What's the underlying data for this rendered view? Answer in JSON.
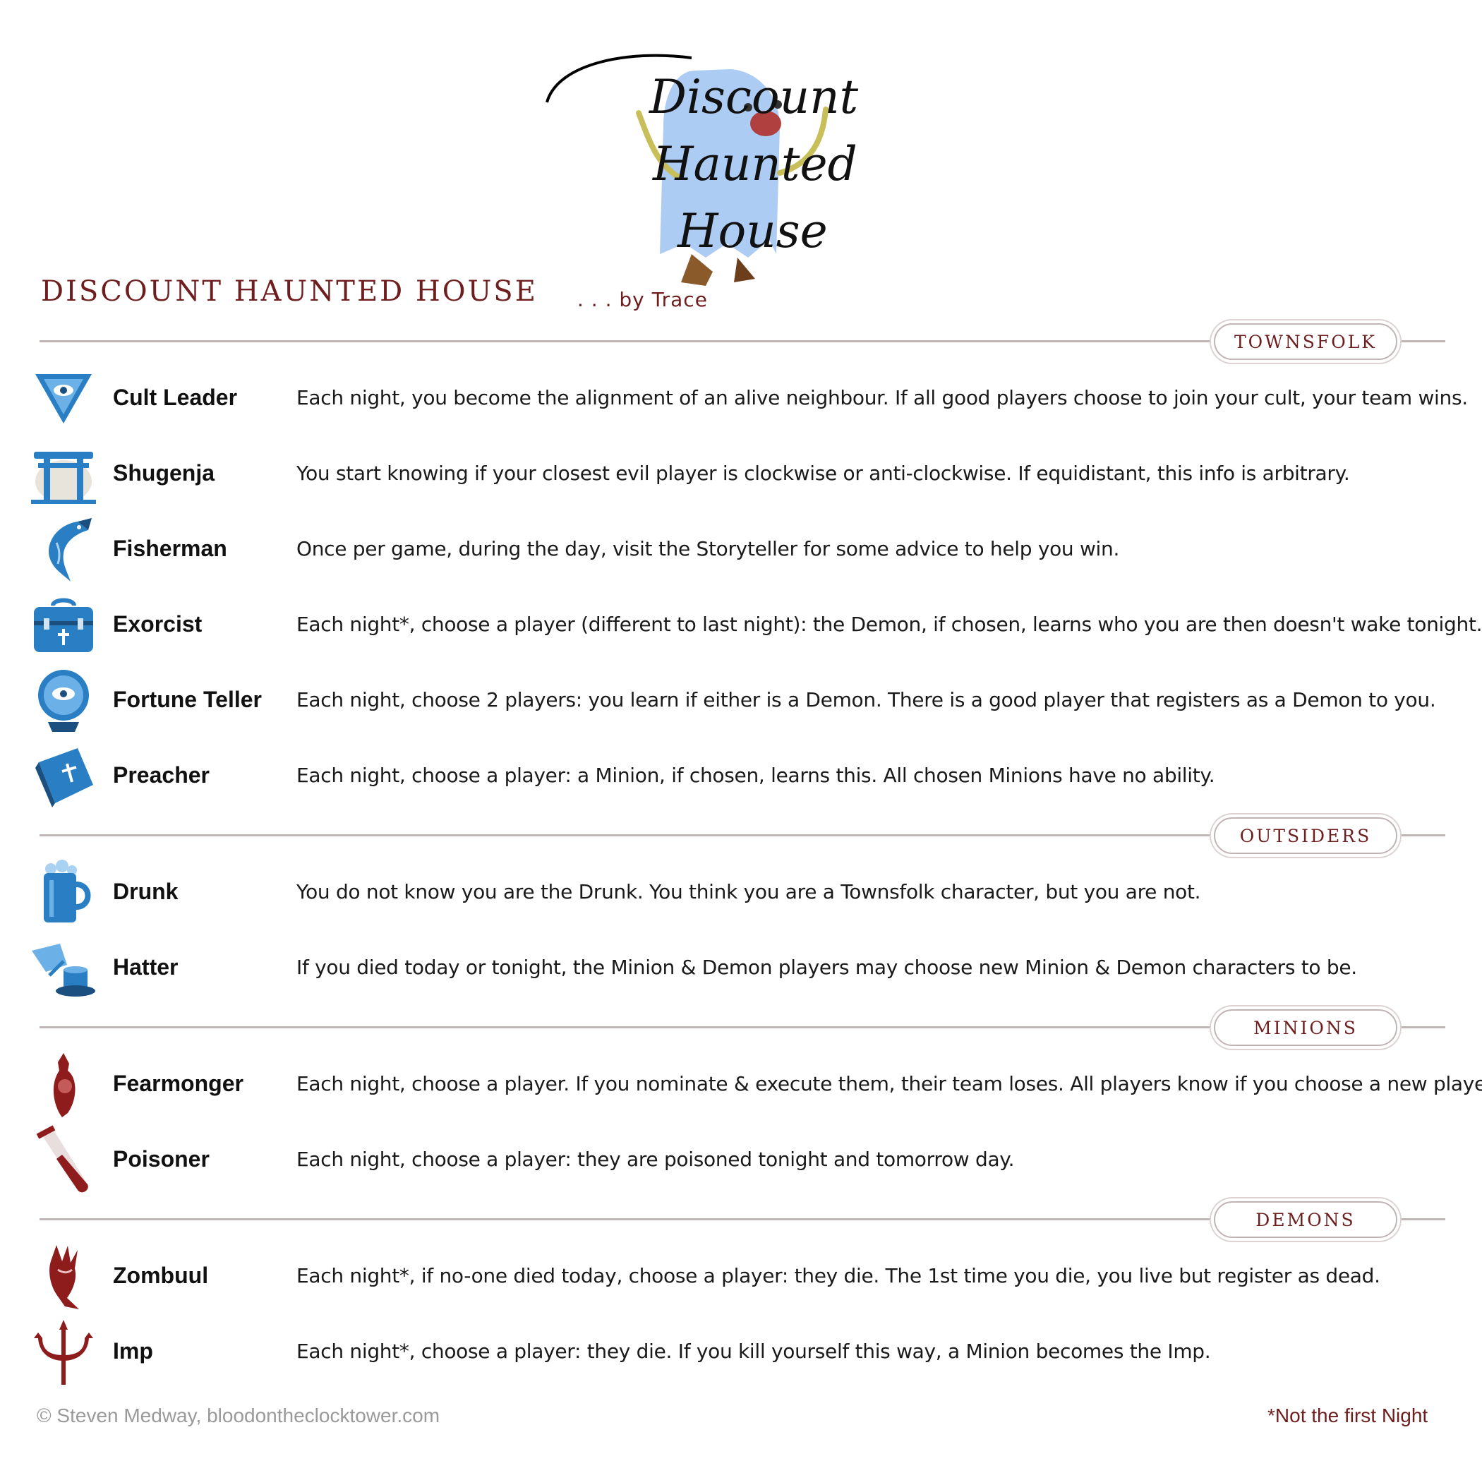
{
  "header": {
    "logo_line1": "Discount",
    "logo_line2": "Haunted",
    "logo_line3": "House",
    "script_name": "DISCOUNT  HAUNTED  HOUSE",
    "author": ". . . by  Trace"
  },
  "teams": {
    "townsfolk": "TOWNSFOLK",
    "outsiders": "OUTSIDERS",
    "minions": "MINIONS",
    "demons": "DEMONS"
  },
  "characters": [
    {
      "name": "Cult Leader",
      "ability": "Each night, you become the alignment of an alive neighbour. If all good players choose to join your cult, your team wins.",
      "icon": "cult-leader-icon"
    },
    {
      "name": "Shugenja",
      "ability": "You start knowing if your closest evil player is clockwise or anti-clockwise. If equidistant, this info is arbitrary.",
      "icon": "shugenja-icon"
    },
    {
      "name": "Fisherman",
      "ability": "Once per game, during the day, visit the Storyteller for some advice to help you win.",
      "icon": "fisherman-icon"
    },
    {
      "name": "Exorcist",
      "ability": "Each night*, choose a player (different to last night): the Demon, if chosen, learns who you are then doesn't wake tonight.",
      "icon": "exorcist-icon"
    },
    {
      "name": "Fortune Teller",
      "ability": "Each night, choose 2 players: you learn if either is a Demon. There is a good player that registers as a Demon to you.",
      "icon": "fortune-teller-icon"
    },
    {
      "name": "Preacher",
      "ability": "Each night, choose a player: a Minion, if chosen, learns this. All chosen Minions have no ability.",
      "icon": "preacher-icon"
    },
    {
      "name": "Drunk",
      "ability": "You do not know you are the Drunk. You think you are a Townsfolk character, but you are not.",
      "icon": "drunk-icon"
    },
    {
      "name": "Hatter",
      "ability": "If you died today or tonight, the Minion & Demon players may choose new Minion & Demon characters to be.",
      "icon": "hatter-icon"
    },
    {
      "name": "Fearmonger",
      "ability": "Each night, choose a player. If you nominate & execute them, their team loses. All players know if you choose a new player.",
      "icon": "fearmonger-icon"
    },
    {
      "name": "Poisoner",
      "ability": "Each night, choose a player: they are poisoned tonight and tomorrow day.",
      "icon": "poisoner-icon"
    },
    {
      "name": "Zombuul",
      "ability": "Each night*, if no-one died today, choose a player: they die. The 1st time you die, you live but register as dead.",
      "icon": "zombuul-icon"
    },
    {
      "name": "Imp",
      "ability": "Each night*, choose a player: they die. If you kill yourself this way, a Minion becomes the Imp.",
      "icon": "imp-icon"
    }
  ],
  "footer": {
    "copyright": "© Steven Medway, bloodontheclocktower.com",
    "note": "*Not the first Night"
  },
  "colors": {
    "good": "#2a7fc4",
    "evil": "#8e1c1c",
    "accent": "#6e1e1e",
    "rule": "#c0b4b4"
  }
}
